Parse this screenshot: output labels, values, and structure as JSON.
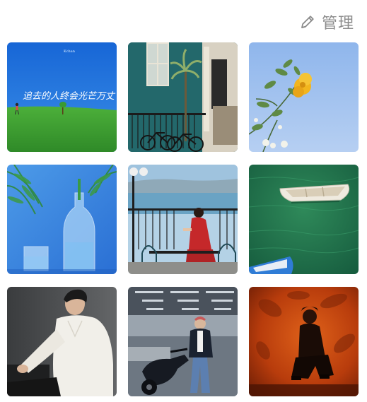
{
  "header": {
    "manage_label": "管理",
    "manage_icon": "pencil-edit-icon"
  },
  "photos": [
    {
      "id": "photo-1",
      "subject": "handwritten-text-over-blue-sky-and-grass",
      "overlay_text": "追去的人终会光芒万丈",
      "tag": "Kchan"
    },
    {
      "id": "photo-2",
      "subject": "teal-house-facade-with-bicycles"
    },
    {
      "id": "photo-3",
      "subject": "yellow-flower-branch-against-blue-sky"
    },
    {
      "id": "photo-4",
      "subject": "glass-bottle-and-glass-with-palm-leaves"
    },
    {
      "id": "photo-5",
      "subject": "woman-in-red-dress-on-balcony-by-lake"
    },
    {
      "id": "photo-6",
      "subject": "rowboats-on-green-water"
    },
    {
      "id": "photo-7",
      "subject": "man-in-white-shirt-seated"
    },
    {
      "id": "photo-8",
      "subject": "man-on-scooter-in-parking-garage"
    },
    {
      "id": "photo-9",
      "subject": "figure-seated-in-orange-shadow-light"
    }
  ],
  "colors": {
    "header_text": "#8d8d8d",
    "background": "#ffffff"
  }
}
